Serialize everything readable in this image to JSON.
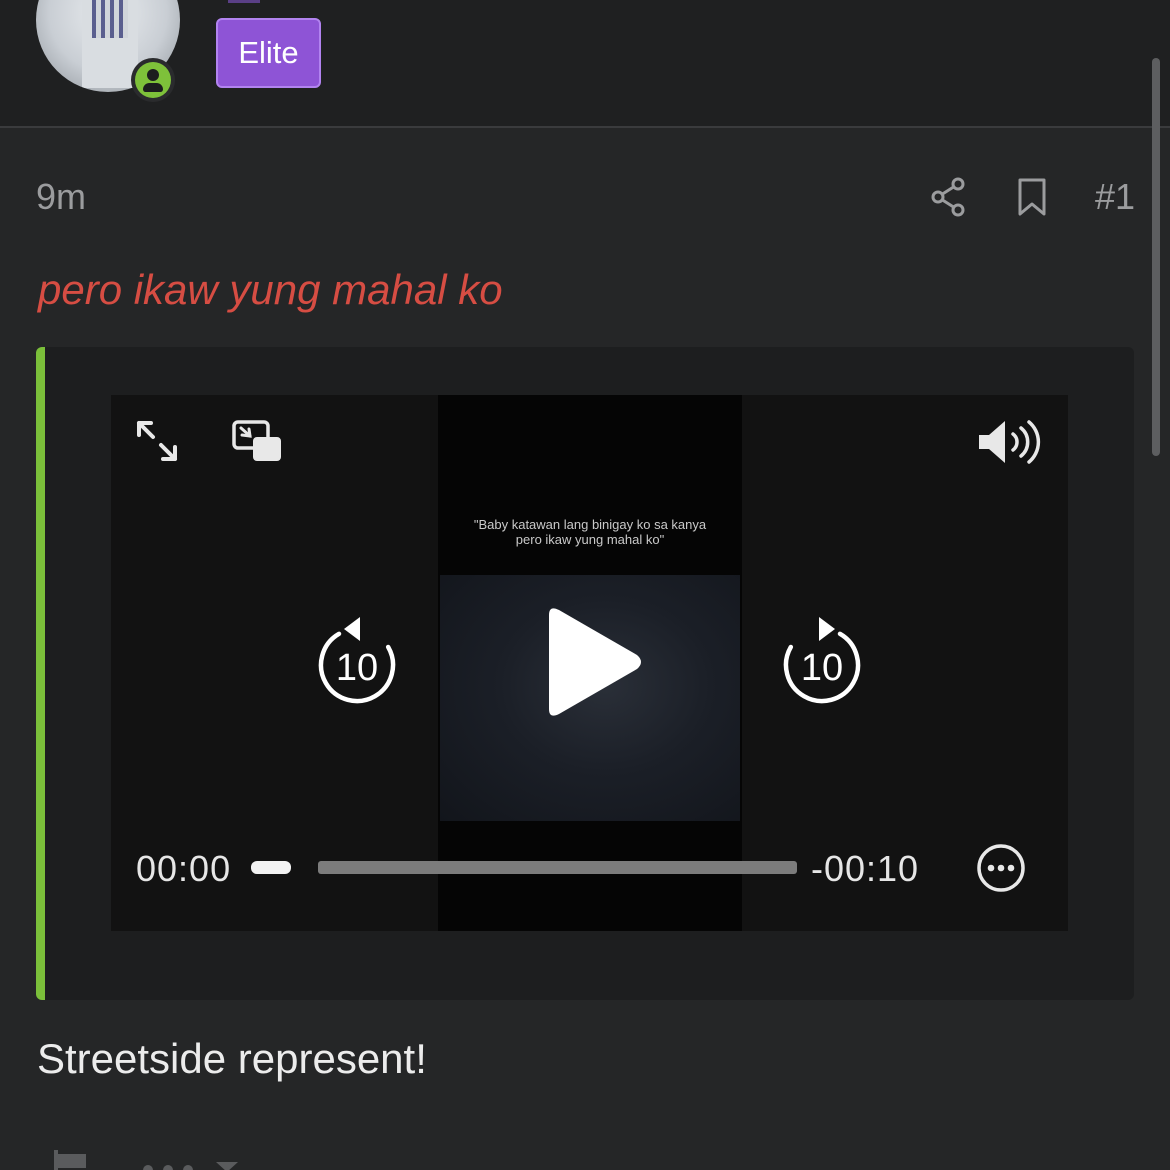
{
  "header": {
    "badge_label": "Elite",
    "online_status": "online"
  },
  "post": {
    "timestamp": "9m",
    "post_number": "#1",
    "quote_title": "pero ikaw yung mahal ko",
    "body": "Streetside represent!"
  },
  "video": {
    "caption_line1": "\"Baby katawan lang binigay ko sa kanya",
    "caption_line2": "pero ikaw yung mahal ko\"",
    "rewind_seconds": "10",
    "forward_seconds": "10",
    "current_time": "00:00",
    "remaining_time": "-00:10",
    "progress": 0
  },
  "colors": {
    "accent_green": "#7bbf3a",
    "badge_purple": "#8e54d6",
    "quote_red": "#d64d43",
    "online_green": "#7ec13a"
  },
  "icons": [
    "share-icon",
    "bookmark-icon",
    "expand-icon",
    "picture-in-picture-icon",
    "volume-icon",
    "rewind-10-icon",
    "play-icon",
    "forward-10-icon",
    "more-options-icon",
    "flag-icon"
  ]
}
